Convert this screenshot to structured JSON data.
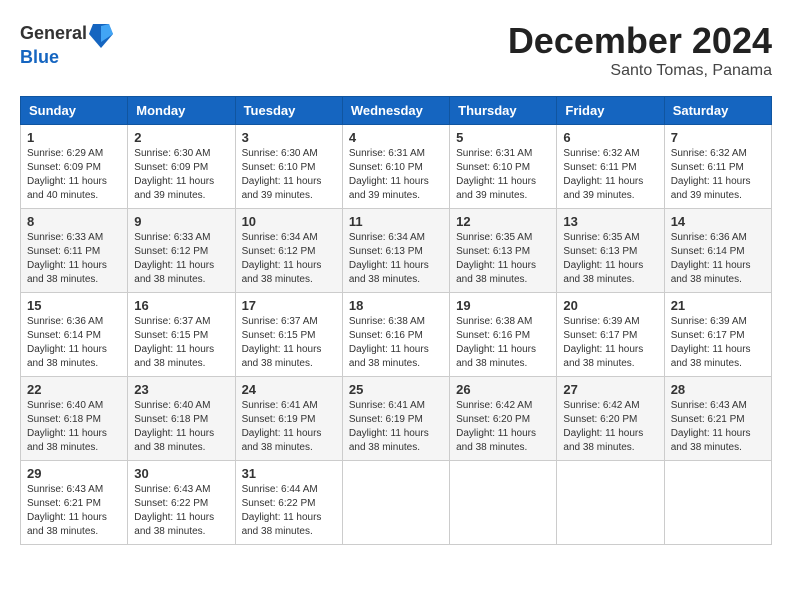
{
  "header": {
    "logo": {
      "line1": "General",
      "line2": "Blue"
    },
    "title": "December 2024",
    "subtitle": "Santo Tomas, Panama"
  },
  "calendar": {
    "days_of_week": [
      "Sunday",
      "Monday",
      "Tuesday",
      "Wednesday",
      "Thursday",
      "Friday",
      "Saturday"
    ],
    "weeks": [
      [
        {
          "day": "1",
          "sunrise": "6:29 AM",
          "sunset": "6:09 PM",
          "daylight": "11 hours and 40 minutes."
        },
        {
          "day": "2",
          "sunrise": "6:30 AM",
          "sunset": "6:09 PM",
          "daylight": "11 hours and 39 minutes."
        },
        {
          "day": "3",
          "sunrise": "6:30 AM",
          "sunset": "6:10 PM",
          "daylight": "11 hours and 39 minutes."
        },
        {
          "day": "4",
          "sunrise": "6:31 AM",
          "sunset": "6:10 PM",
          "daylight": "11 hours and 39 minutes."
        },
        {
          "day": "5",
          "sunrise": "6:31 AM",
          "sunset": "6:10 PM",
          "daylight": "11 hours and 39 minutes."
        },
        {
          "day": "6",
          "sunrise": "6:32 AM",
          "sunset": "6:11 PM",
          "daylight": "11 hours and 39 minutes."
        },
        {
          "day": "7",
          "sunrise": "6:32 AM",
          "sunset": "6:11 PM",
          "daylight": "11 hours and 39 minutes."
        }
      ],
      [
        {
          "day": "8",
          "sunrise": "6:33 AM",
          "sunset": "6:11 PM",
          "daylight": "11 hours and 38 minutes."
        },
        {
          "day": "9",
          "sunrise": "6:33 AM",
          "sunset": "6:12 PM",
          "daylight": "11 hours and 38 minutes."
        },
        {
          "day": "10",
          "sunrise": "6:34 AM",
          "sunset": "6:12 PM",
          "daylight": "11 hours and 38 minutes."
        },
        {
          "day": "11",
          "sunrise": "6:34 AM",
          "sunset": "6:13 PM",
          "daylight": "11 hours and 38 minutes."
        },
        {
          "day": "12",
          "sunrise": "6:35 AM",
          "sunset": "6:13 PM",
          "daylight": "11 hours and 38 minutes."
        },
        {
          "day": "13",
          "sunrise": "6:35 AM",
          "sunset": "6:13 PM",
          "daylight": "11 hours and 38 minutes."
        },
        {
          "day": "14",
          "sunrise": "6:36 AM",
          "sunset": "6:14 PM",
          "daylight": "11 hours and 38 minutes."
        }
      ],
      [
        {
          "day": "15",
          "sunrise": "6:36 AM",
          "sunset": "6:14 PM",
          "daylight": "11 hours and 38 minutes."
        },
        {
          "day": "16",
          "sunrise": "6:37 AM",
          "sunset": "6:15 PM",
          "daylight": "11 hours and 38 minutes."
        },
        {
          "day": "17",
          "sunrise": "6:37 AM",
          "sunset": "6:15 PM",
          "daylight": "11 hours and 38 minutes."
        },
        {
          "day": "18",
          "sunrise": "6:38 AM",
          "sunset": "6:16 PM",
          "daylight": "11 hours and 38 minutes."
        },
        {
          "day": "19",
          "sunrise": "6:38 AM",
          "sunset": "6:16 PM",
          "daylight": "11 hours and 38 minutes."
        },
        {
          "day": "20",
          "sunrise": "6:39 AM",
          "sunset": "6:17 PM",
          "daylight": "11 hours and 38 minutes."
        },
        {
          "day": "21",
          "sunrise": "6:39 AM",
          "sunset": "6:17 PM",
          "daylight": "11 hours and 38 minutes."
        }
      ],
      [
        {
          "day": "22",
          "sunrise": "6:40 AM",
          "sunset": "6:18 PM",
          "daylight": "11 hours and 38 minutes."
        },
        {
          "day": "23",
          "sunrise": "6:40 AM",
          "sunset": "6:18 PM",
          "daylight": "11 hours and 38 minutes."
        },
        {
          "day": "24",
          "sunrise": "6:41 AM",
          "sunset": "6:19 PM",
          "daylight": "11 hours and 38 minutes."
        },
        {
          "day": "25",
          "sunrise": "6:41 AM",
          "sunset": "6:19 PM",
          "daylight": "11 hours and 38 minutes."
        },
        {
          "day": "26",
          "sunrise": "6:42 AM",
          "sunset": "6:20 PM",
          "daylight": "11 hours and 38 minutes."
        },
        {
          "day": "27",
          "sunrise": "6:42 AM",
          "sunset": "6:20 PM",
          "daylight": "11 hours and 38 minutes."
        },
        {
          "day": "28",
          "sunrise": "6:43 AM",
          "sunset": "6:21 PM",
          "daylight": "11 hours and 38 minutes."
        }
      ],
      [
        {
          "day": "29",
          "sunrise": "6:43 AM",
          "sunset": "6:21 PM",
          "daylight": "11 hours and 38 minutes."
        },
        {
          "day": "30",
          "sunrise": "6:43 AM",
          "sunset": "6:22 PM",
          "daylight": "11 hours and 38 minutes."
        },
        {
          "day": "31",
          "sunrise": "6:44 AM",
          "sunset": "6:22 PM",
          "daylight": "11 hours and 38 minutes."
        },
        null,
        null,
        null,
        null
      ]
    ]
  }
}
